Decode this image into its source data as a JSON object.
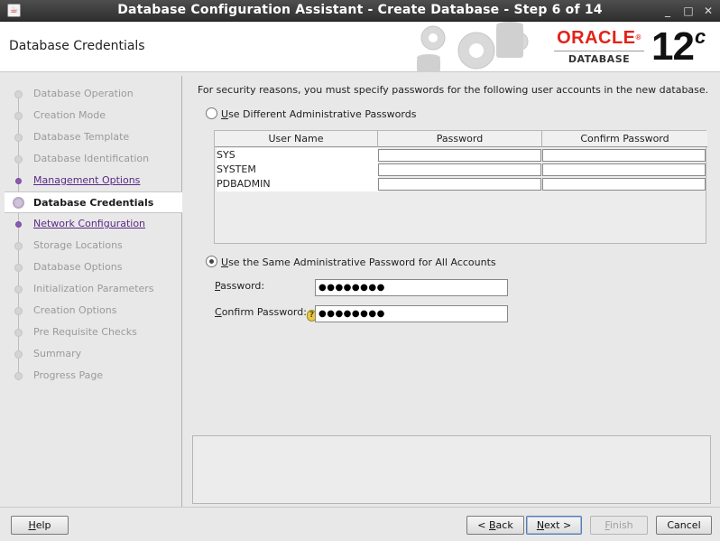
{
  "window": {
    "title": "Database Configuration Assistant - Create Database - Step 6 of 14"
  },
  "header": {
    "page_title": "Database Credentials",
    "logo_word": "ORACLE",
    "logo_registered": "®",
    "logo_sub": "DATABASE",
    "version": "12",
    "version_suffix": "c"
  },
  "sidebar": {
    "steps": [
      {
        "label": "Database Operation",
        "state": "disabled"
      },
      {
        "label": "Creation Mode",
        "state": "disabled"
      },
      {
        "label": "Database Template",
        "state": "disabled"
      },
      {
        "label": "Database Identification",
        "state": "disabled"
      },
      {
        "label": "Management Options",
        "state": "link"
      },
      {
        "label": "Database Credentials",
        "state": "current"
      },
      {
        "label": "Network Configuration",
        "state": "link"
      },
      {
        "label": "Storage Locations",
        "state": "disabled"
      },
      {
        "label": "Database Options",
        "state": "disabled"
      },
      {
        "label": "Initialization Parameters",
        "state": "disabled"
      },
      {
        "label": "Creation Options",
        "state": "disabled"
      },
      {
        "label": "Pre Requisite Checks",
        "state": "disabled"
      },
      {
        "label": "Summary",
        "state": "disabled"
      },
      {
        "label": "Progress Page",
        "state": "disabled"
      }
    ]
  },
  "main": {
    "intro": "For security reasons, you must specify passwords for the following user accounts in the new database.",
    "option_different": {
      "mnemonic": "U",
      "rest": "se Different Administrative Passwords",
      "checked": false
    },
    "table": {
      "headers": [
        "User Name",
        "Password",
        "Confirm Password"
      ],
      "rows": [
        {
          "user": "SYS",
          "password": "",
          "confirm": ""
        },
        {
          "user": "SYSTEM",
          "password": "",
          "confirm": ""
        },
        {
          "user": "PDBADMIN",
          "password": "",
          "confirm": ""
        }
      ]
    },
    "option_same": {
      "mnemonic": "U",
      "rest": "se the Same Administrative Password for All Accounts",
      "checked": true
    },
    "password": {
      "mnemonic": "P",
      "rest": "assword:",
      "value": "●●●●●●●●"
    },
    "confirm_password": {
      "mnemonic": "C",
      "rest": "onfirm Password:",
      "value": "●●●●●●●●",
      "help_icon": "?"
    },
    "message_panel_text": ""
  },
  "footer": {
    "help": {
      "mnemonic": "H",
      "rest": "elp"
    },
    "back": {
      "pre": "< ",
      "mnemonic": "B",
      "rest": "ack"
    },
    "next": {
      "mnemonic": "N",
      "rest": "ext >"
    },
    "finish": {
      "mnemonic": "F",
      "rest": "inish",
      "enabled": false
    },
    "cancel": {
      "label": "Cancel"
    }
  },
  "icons": {
    "app": "java-cup-icon",
    "minimize": "_",
    "maximize": "□",
    "close": "✕"
  },
  "colors": {
    "link": "#5b2a86",
    "oracle_red": "#e2231a",
    "disabled_text": "#9a9a9a"
  }
}
